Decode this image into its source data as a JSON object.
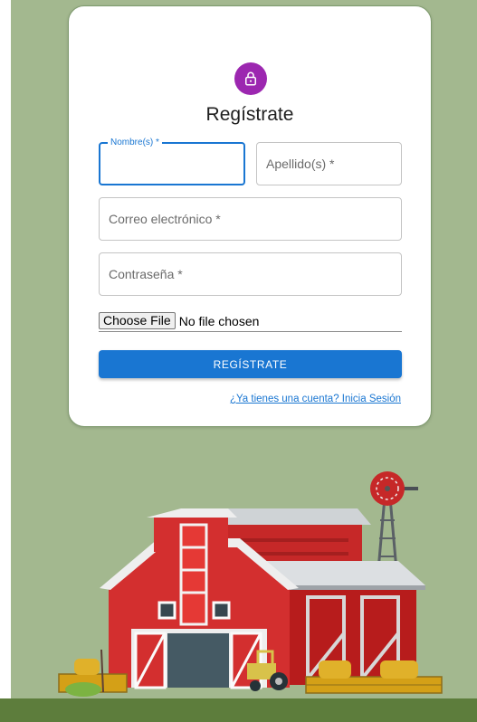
{
  "form": {
    "title": "Regístrate",
    "first_name": {
      "label": "Nombre(s) *",
      "value": ""
    },
    "last_name": {
      "placeholder": "Apellido(s) *"
    },
    "email": {
      "placeholder": "Correo electrónico *"
    },
    "password": {
      "placeholder": "Contraseña *"
    },
    "file": {
      "button_label": "Choose File",
      "status": "No file chosen"
    },
    "submit_label": "REGÍSTRATE",
    "login_link": "¿Ya tienes una cuenta? Inicia Sesión"
  },
  "icons": {
    "avatar": "lock-icon"
  },
  "colors": {
    "primary": "#1976d2",
    "avatar": "#9c27b0",
    "background": "#a3b88f",
    "ground": "#5d7d3c",
    "barn": "#d32f2f"
  }
}
